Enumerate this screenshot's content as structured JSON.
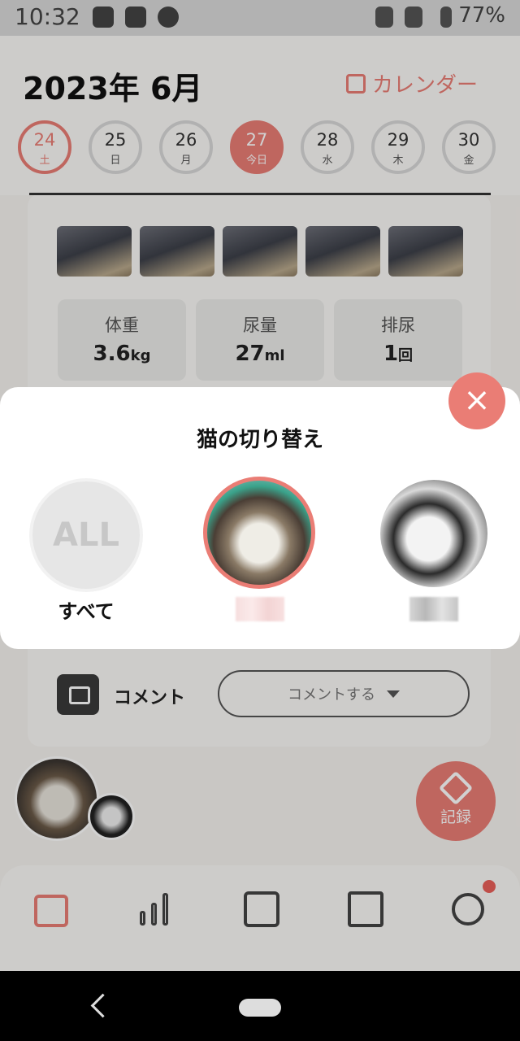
{
  "status_bar": {
    "time": "10:32",
    "battery": "77%"
  },
  "header": {
    "year_month": "2023年 6月",
    "calendar_link": "カレンダー"
  },
  "days": [
    {
      "num": "24",
      "wd": "土"
    },
    {
      "num": "25",
      "wd": "日"
    },
    {
      "num": "26",
      "wd": "月"
    },
    {
      "num": "27",
      "wd": "今日"
    },
    {
      "num": "28",
      "wd": "水"
    },
    {
      "num": "29",
      "wd": "木"
    },
    {
      "num": "30",
      "wd": "金"
    }
  ],
  "stats": [
    {
      "label": "体重",
      "value": "3.6",
      "unit": "kg"
    },
    {
      "label": "尿量",
      "value": "27",
      "unit": "ml"
    },
    {
      "label": "排尿",
      "value": "1",
      "unit": "回"
    }
  ],
  "comment": {
    "label": "コメント",
    "button": "コメントする"
  },
  "record_button": "記録",
  "modal": {
    "title": "猫の切り替え",
    "all_badge": "ALL",
    "all_label": "すべて",
    "close": "×"
  },
  "colors": {
    "accent": "#ea7d75"
  }
}
